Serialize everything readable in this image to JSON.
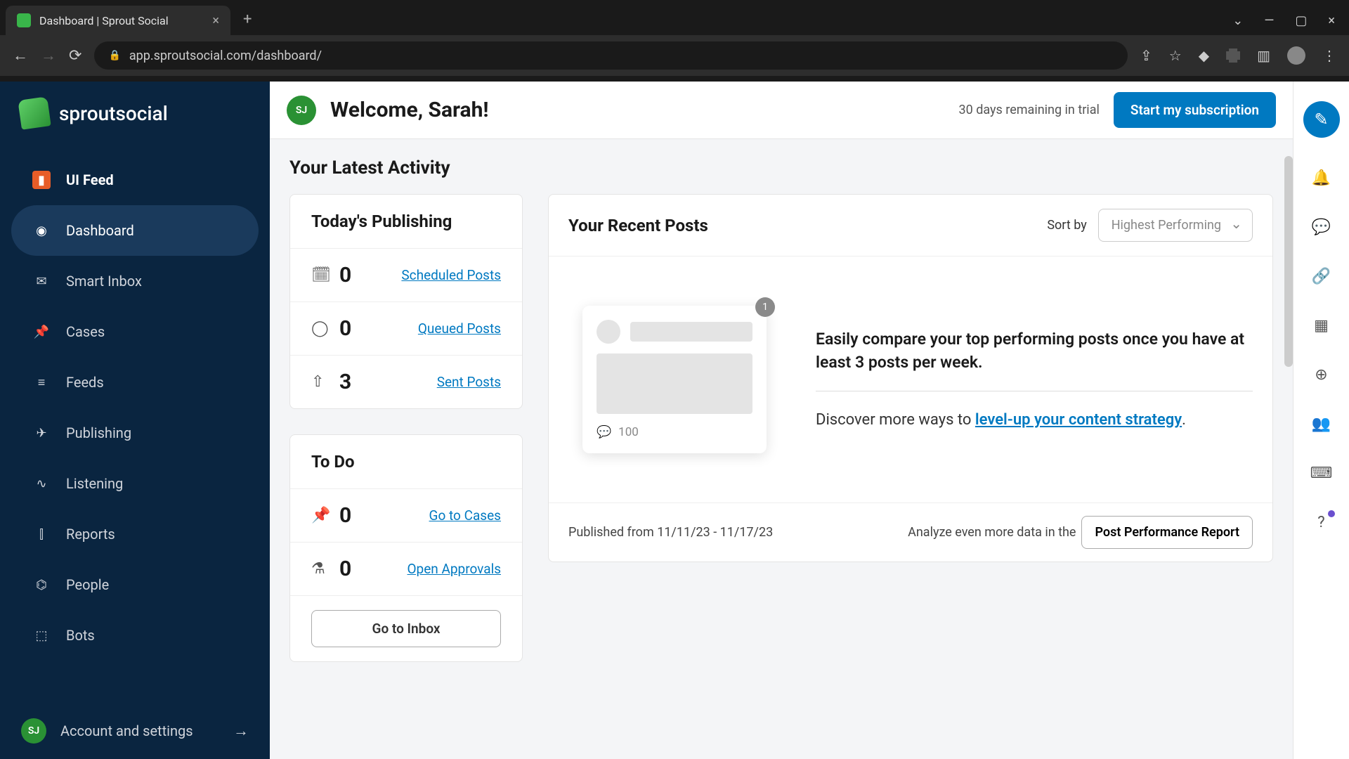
{
  "browser": {
    "tab_title": "Dashboard | Sprout Social",
    "url": "app.sproutsocial.com/dashboard/"
  },
  "brand": "sproutsocial",
  "user_initials": "SJ",
  "sidebar": {
    "ui_feed": "UI Feed",
    "items": [
      {
        "icon": "◉",
        "label": "Dashboard",
        "active": true
      },
      {
        "icon": "✉",
        "label": "Smart Inbox"
      },
      {
        "icon": "📌",
        "label": "Cases"
      },
      {
        "icon": "≡",
        "label": "Feeds"
      },
      {
        "icon": "✈",
        "label": "Publishing"
      },
      {
        "icon": "∿",
        "label": "Listening"
      },
      {
        "icon": "⫿",
        "label": "Reports"
      },
      {
        "icon": "⌬",
        "label": "People"
      },
      {
        "icon": "⬚",
        "label": "Bots"
      }
    ],
    "footer_label": "Account and settings"
  },
  "header": {
    "welcome": "Welcome, Sarah!",
    "trial_text": "30 days remaining in trial",
    "cta": "Start my subscription"
  },
  "activity_title": "Your Latest Activity",
  "publishing": {
    "title": "Today's Publishing",
    "rows": [
      {
        "count": "0",
        "link": "Scheduled Posts"
      },
      {
        "count": "0",
        "link": "Queued Posts"
      },
      {
        "count": "3",
        "link": "Sent Posts"
      }
    ]
  },
  "todo": {
    "title": "To Do",
    "rows": [
      {
        "count": "0",
        "link": "Go to Cases"
      },
      {
        "count": "0",
        "link": "Open Approvals"
      }
    ],
    "inbox_btn": "Go to Inbox"
  },
  "posts": {
    "title": "Your Recent Posts",
    "sort_label": "Sort by",
    "sort_value": "Highest Performing",
    "mock_badge": "1",
    "mock_comments": "100",
    "lead": "Easily compare your top performing posts once you have at least 3 posts per week.",
    "sub_prefix": "Discover more ways to ",
    "sub_link": "level-up your content strategy",
    "sub_suffix": ".",
    "footer_published": "Published from 11/11/23 - 11/17/23",
    "footer_analyze": "Analyze even more data in the",
    "footer_report_btn": "Post Performance Report"
  }
}
